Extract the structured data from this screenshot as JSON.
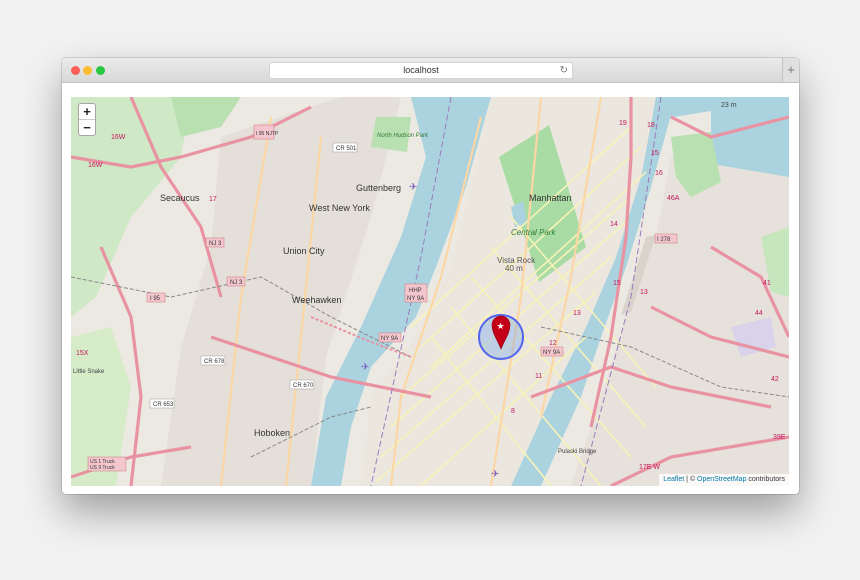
{
  "browser": {
    "url": "localhost",
    "reload_icon": "reload-icon",
    "new_tab_label": "+"
  },
  "map": {
    "zoom_in": "+",
    "zoom_out": "−",
    "attribution": {
      "leaflet": "Leaflet",
      "separator": " | © ",
      "osm": "OpenStreetMap",
      "suffix": " contributors"
    },
    "colors": {
      "water": "#aad3df",
      "park": "#a8dca4",
      "motorway": "#e892a2",
      "primary": "#fcd6a4",
      "secondary": "#f7fabf",
      "marker": "#c40018",
      "circle": "#3388ff"
    },
    "marker_icon": "star-map-marker-icon",
    "labels": {
      "secaucus": "Secaucus",
      "guttenberg": "Guttenberg",
      "west_new_york": "West New York",
      "union_city": "Union City",
      "weehawken": "Weehawken",
      "hoboken": "Hoboken",
      "manhattan": "Manhattan",
      "central_park": "Central Park",
      "vista_rock": "Vista Rock",
      "vista_rock_elev": "40 m",
      "north_hudson_park": "North Hudson Park",
      "little_snake": "Little Snake",
      "pulaski_bridge": "Pulaski Bridge",
      "elev_23": "23 m",
      "rt_cr501": "CR 501",
      "rt_cr678": "CR 678",
      "rt_cr670": "CR 670",
      "rt_cr653": "CR 653",
      "rt_i95_nj": "I 95 NJTP",
      "rt_i95": "I 95",
      "rt_nj3a": "NJ 3",
      "rt_nj3b": "NJ 3",
      "rt_hhp": "HHP",
      "rt_ny9a": "NY 9A",
      "rt_ny9a_2": "NY 9A",
      "rt_ny9a_3": "NY 9A",
      "rt_i278": "I 278",
      "rt_us1": "US 1 Truck",
      "rt_us9": "US 9 Truck",
      "ex_16w": "16W",
      "ex_16w_2": "16W",
      "ex_15x": "15X",
      "ex_17": "17",
      "ex_17e": "17E W",
      "ex_46a": "46A",
      "ex_44": "44",
      "ex_42": "42",
      "ex_39": "39E",
      "n_13": "13",
      "n_12": "12",
      "n_11": "11",
      "n_8": "8",
      "n_14": "14",
      "n_15": "15",
      "n_16": "16",
      "n_18": "18",
      "n_19": "19",
      "n_13b": "13",
      "n_15b": "15",
      "n_41": "41"
    }
  }
}
